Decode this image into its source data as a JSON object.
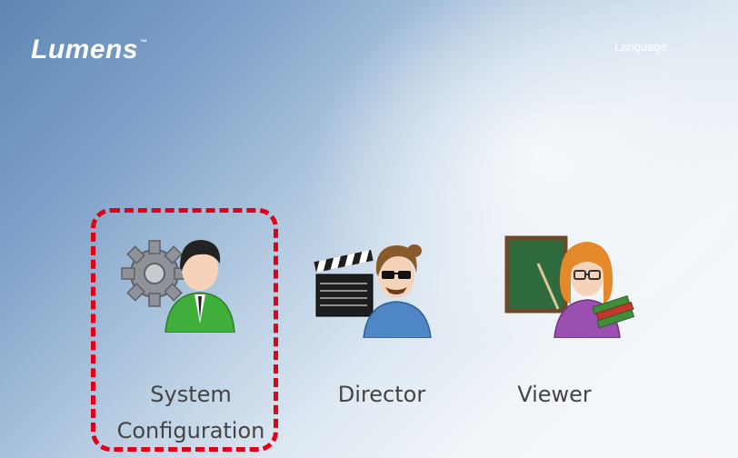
{
  "header": {
    "logo_text": "Lumens",
    "logo_tm": "™",
    "language_label": "Language"
  },
  "roles": [
    {
      "label_line1": "System",
      "label_line2": "Configuration",
      "icon": "admin-gear-icon"
    },
    {
      "label": "Director",
      "icon": "director-clapperboard-icon"
    },
    {
      "label": "Viewer",
      "icon": "viewer-teacher-icon"
    }
  ],
  "highlight": {
    "target": "System Configuration",
    "color": "#e0001a"
  },
  "colors": {
    "accent_red": "#e0001a",
    "label_text": "#444444"
  }
}
